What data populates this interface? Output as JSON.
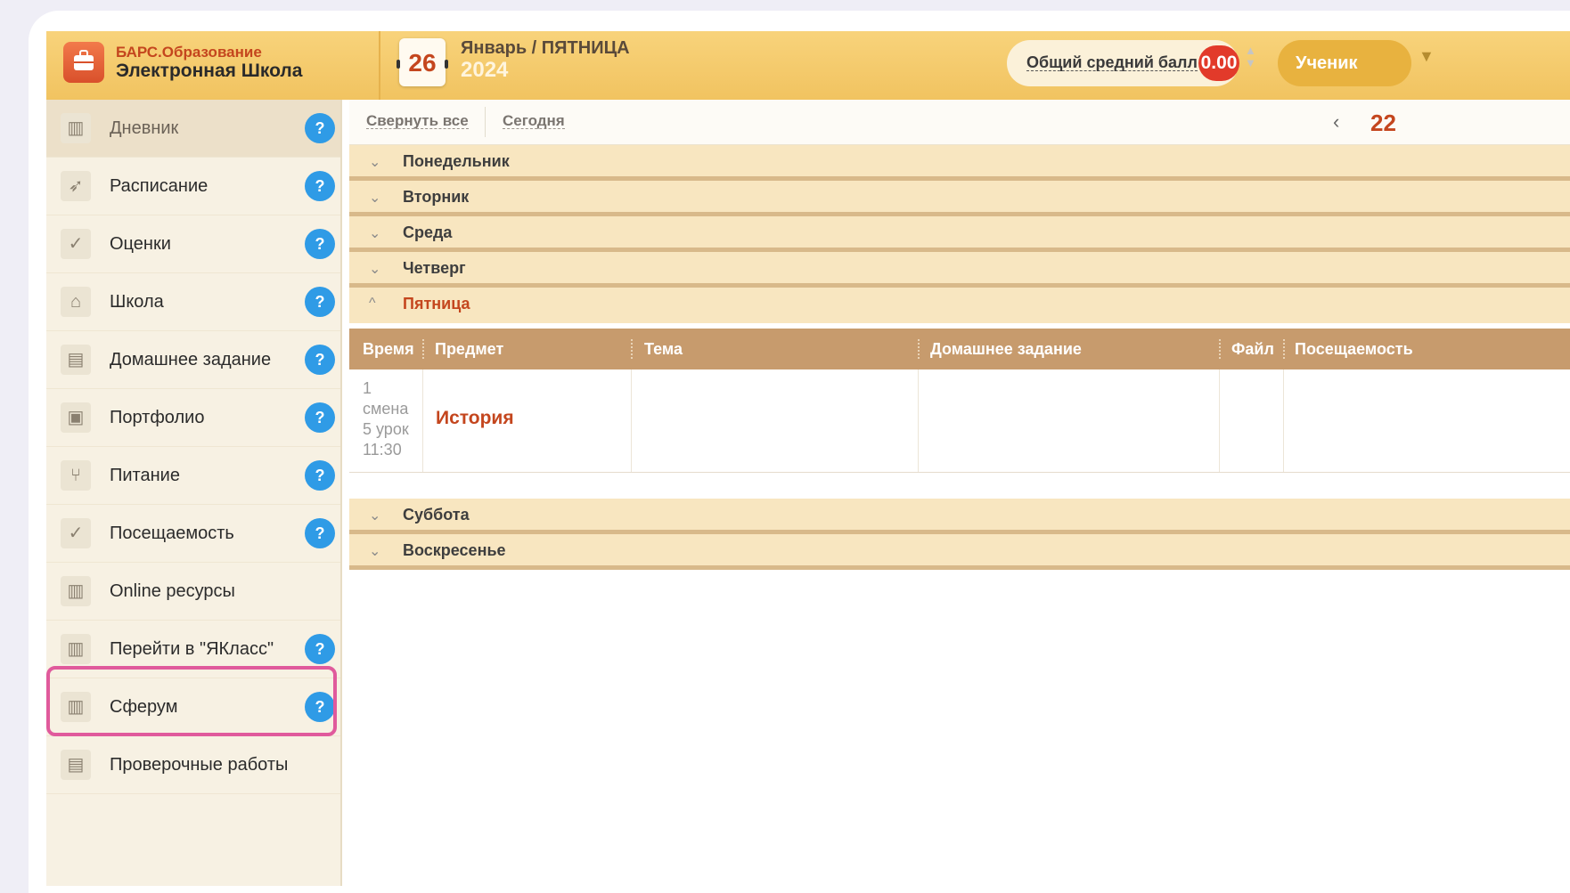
{
  "header": {
    "brand_top": "БАРС.Образование",
    "brand_main": "Электронная Школа",
    "date_day": "26",
    "month_line": "Январь / ПЯТНИЦА",
    "year": "2024",
    "avg_label": "Общий средний балл",
    "avg_value": "0.00",
    "role": "Ученик"
  },
  "sidebar": {
    "items": [
      {
        "label": "Дневник",
        "icon": "book-icon",
        "help": "?"
      },
      {
        "label": "Расписание",
        "icon": "rocket-icon",
        "help": "?"
      },
      {
        "label": "Оценки",
        "icon": "check-icon",
        "help": "?"
      },
      {
        "label": "Школа",
        "icon": "school-icon",
        "help": "?"
      },
      {
        "label": "Домашнее задание",
        "icon": "board-icon",
        "help": "?"
      },
      {
        "label": "Портфолио",
        "icon": "briefcase-icon",
        "help": "?"
      },
      {
        "label": "Питание",
        "icon": "cutlery-icon",
        "help": "?"
      },
      {
        "label": "Посещаемость",
        "icon": "check-icon",
        "help": "?"
      },
      {
        "label": "Online ресурсы",
        "icon": "book-icon"
      },
      {
        "label": "Перейти в \"ЯКласс\"",
        "icon": "book-icon",
        "help": "?"
      },
      {
        "label": "Сферум",
        "icon": "book-icon",
        "help": "?"
      },
      {
        "label": "Проверочные работы",
        "icon": "document-icon"
      }
    ]
  },
  "toolbar": {
    "collapse_all": "Свернуть все",
    "today": "Сегодня",
    "week_number": "22"
  },
  "days": [
    {
      "label": "Понедельник",
      "chevron": "⌄"
    },
    {
      "label": "Вторник",
      "chevron": "⌄"
    },
    {
      "label": "Среда",
      "chevron": "⌄"
    },
    {
      "label": "Четверг",
      "chevron": "⌄"
    },
    {
      "label": "Пятница",
      "chevron": "^"
    },
    {
      "label": "Суббота",
      "chevron": "⌄"
    },
    {
      "label": "Воскресенье",
      "chevron": "⌄"
    }
  ],
  "table": {
    "headers": [
      "Время",
      "Предмет",
      "Тема",
      "Домашнее задание",
      "Файл",
      "Посещаемость"
    ],
    "row": {
      "time_lines": [
        "1",
        "смена",
        "5 урок",
        "11:30"
      ],
      "subject": "История"
    }
  },
  "colors": {
    "accent": "#c4461e",
    "header": "#f1c360",
    "help": "#2f9be6",
    "highlight": "#e05a9c"
  }
}
